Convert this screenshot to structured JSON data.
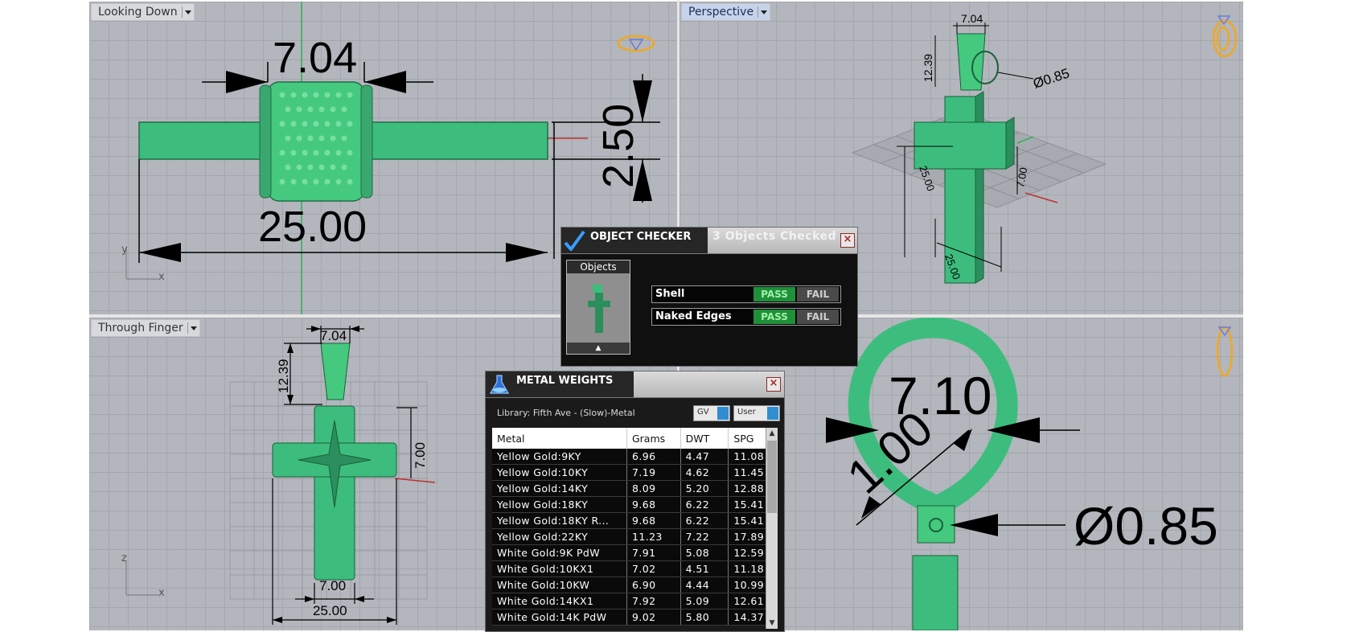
{
  "viewports": {
    "top": {
      "label": "Looking Down",
      "dims": [
        "7.04",
        "2.50",
        "25.00"
      ],
      "axes": {
        "v": "y",
        "h": "x"
      }
    },
    "perspective": {
      "label": "Perspective",
      "dims": [
        "7.04",
        "12.39",
        "Ø0.85",
        "25.00",
        "25.00",
        "7.00"
      ]
    },
    "front": {
      "label": "Through Finger",
      "dims": [
        "7.04",
        "12.39",
        "7.00",
        "7.00",
        "25.00"
      ],
      "axes": {
        "v": "z",
        "h": "x"
      }
    },
    "detail": {
      "dims": [
        "7.10",
        "1.00",
        "Ø0.85"
      ]
    }
  },
  "object_checker": {
    "title": "OBJECT CHECKER",
    "status": "3  Objects Checked",
    "objects_label": "Objects",
    "checks": [
      {
        "label": "Shell",
        "pass": "PASS",
        "fail": "FAIL"
      },
      {
        "label": "Naked Edges",
        "pass": "PASS",
        "fail": "FAIL"
      }
    ]
  },
  "metal_weights": {
    "title": "METAL WEIGHTS",
    "library": "Library: Fifth Ave - (Slow)-Metal",
    "gv_label": "GV",
    "user_label": "User",
    "columns": [
      "Metal",
      "Grams",
      "DWT",
      "SPG"
    ],
    "rows": [
      [
        "Yellow Gold:9KY",
        "6.96",
        "4.47",
        "11.08"
      ],
      [
        "Yellow Gold:10KY",
        "7.19",
        "4.62",
        "11.45"
      ],
      [
        "Yellow Gold:14KY",
        "8.09",
        "5.20",
        "12.88"
      ],
      [
        "Yellow Gold:18KY",
        "9.68",
        "6.22",
        "15.41"
      ],
      [
        "Yellow Gold:18KY R...",
        "9.68",
        "6.22",
        "15.41"
      ],
      [
        "Yellow Gold:22KY",
        "11.23",
        "7.22",
        "17.89"
      ],
      [
        "White Gold:9K PdW",
        "7.91",
        "5.08",
        "12.59"
      ],
      [
        "White Gold:10KX1",
        "7.02",
        "4.51",
        "11.18"
      ],
      [
        "White Gold:10KW",
        "6.90",
        "4.44",
        "10.99"
      ],
      [
        "White Gold:14KX1",
        "7.92",
        "5.09",
        "12.61"
      ],
      [
        "White Gold:14K PdW",
        "9.02",
        "5.80",
        "14.37"
      ]
    ]
  },
  "colors": {
    "model": "#3dbd7d",
    "model_dark": "#2a8f5c",
    "viewport_bg": "#b3b6bc",
    "gizmo": "#f0a820",
    "pass": "#1f8f3a"
  }
}
